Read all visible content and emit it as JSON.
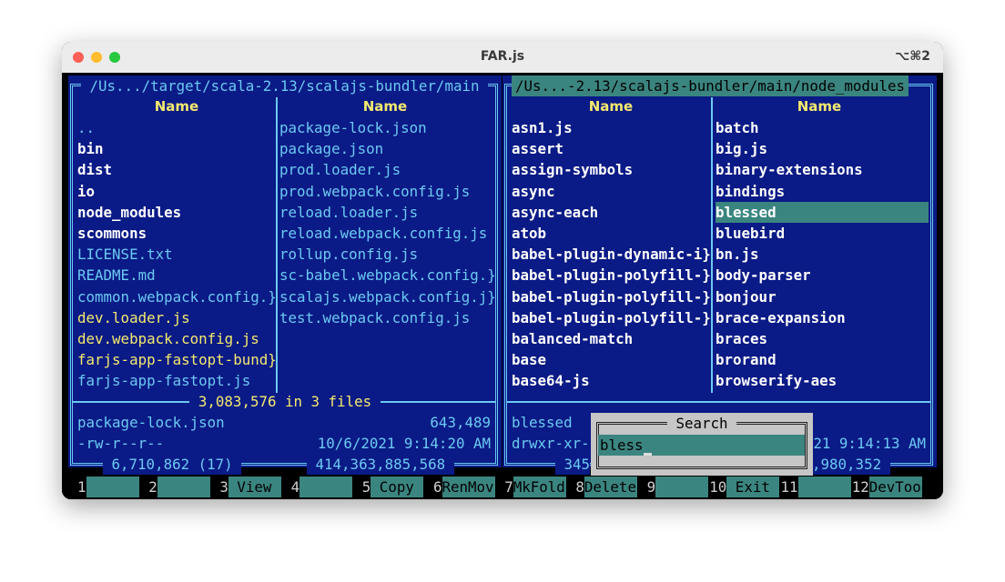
{
  "window": {
    "title": "FAR.js",
    "shortcut": "⌥⌘2",
    "traffic_lights": {
      "close": "#fe5f57",
      "minimize": "#febc2e",
      "zoom": "#28c840"
    }
  },
  "colors": {
    "background": "#0a1a86",
    "border": "#6ccaf2",
    "directory": "#ffffff",
    "file": "#6ccaf2",
    "script": "#f4ea6e",
    "selection": "#3b8580"
  },
  "left_panel": {
    "path": " /Us.../target/scala-2.13/scalajs-bundler/main ",
    "column_header": "Name",
    "col1": [
      {
        "name": "..",
        "kind": "file"
      },
      {
        "name": "bin",
        "kind": "dir"
      },
      {
        "name": "dist",
        "kind": "dir"
      },
      {
        "name": "io",
        "kind": "dir"
      },
      {
        "name": "node_modules",
        "kind": "dir"
      },
      {
        "name": "scommons",
        "kind": "dir"
      },
      {
        "name": "LICENSE.txt",
        "kind": "file"
      },
      {
        "name": "README.md",
        "kind": "file"
      },
      {
        "name": "common.webpack.config.}",
        "kind": "file"
      },
      {
        "name": "dev.loader.js",
        "kind": "script"
      },
      {
        "name": "dev.webpack.config.js",
        "kind": "script"
      },
      {
        "name": "farjs-app-fastopt-bund}",
        "kind": "script"
      },
      {
        "name": "farjs-app-fastopt.js",
        "kind": "file"
      }
    ],
    "col2": [
      {
        "name": "package-lock.json",
        "kind": "file"
      },
      {
        "name": "package.json",
        "kind": "file"
      },
      {
        "name": "prod.loader.js",
        "kind": "file"
      },
      {
        "name": "prod.webpack.config.js",
        "kind": "file"
      },
      {
        "name": "reload.loader.js",
        "kind": "file"
      },
      {
        "name": "reload.webpack.config.js",
        "kind": "file"
      },
      {
        "name": "rollup.config.js",
        "kind": "file"
      },
      {
        "name": "sc-babel.webpack.config.}",
        "kind": "file"
      },
      {
        "name": "scalajs.webpack.config.j}",
        "kind": "file"
      },
      {
        "name": "test.webpack.config.js",
        "kind": "file"
      }
    ],
    "selection_summary": " 3,083,576 in 3 files ",
    "info": {
      "name": "package-lock.json",
      "size": "643,489",
      "perms": "-rw-r--r--",
      "date": "10/6/2021 9:14:20 AM"
    },
    "footer": {
      "files": " 6,710,862 (17) ",
      "free": " 414,363,885,568 "
    }
  },
  "right_panel": {
    "path": "/Us...-2.13/scalajs-bundler/main/node_modules",
    "column_header": "Name",
    "selected": "blessed",
    "col1": [
      "asn1.js",
      "assert",
      "assign-symbols",
      "async",
      "async-each",
      "atob",
      "babel-plugin-dynamic-i}",
      "babel-plugin-polyfill-}",
      "babel-plugin-polyfill-}",
      "babel-plugin-polyfill-}",
      "balanced-match",
      "base",
      "base64-js"
    ],
    "col2": [
      "batch",
      "big.js",
      "binary-extensions",
      "bindings",
      "blessed",
      "bluebird",
      "bn.js",
      "body-parser",
      "bonjour",
      "brace-expansion",
      "braces",
      "brorand",
      "browserify-aes"
    ],
    "info": {
      "name": "blessed",
      "perms_visible": "drwxr-xr-",
      "date_visible": "21 9:14:13 AM"
    },
    "footer": {
      "files_visible": " 345",
      "free_visible": ",980,352 "
    }
  },
  "search_dialog": {
    "title": " Search ",
    "value": "bless"
  },
  "function_keys": [
    {
      "num": "1",
      "label": ""
    },
    {
      "num": "2",
      "label": ""
    },
    {
      "num": "3",
      "label": " View"
    },
    {
      "num": "4",
      "label": ""
    },
    {
      "num": "5",
      "label": " Copy"
    },
    {
      "num": "6",
      "label": "RenMov"
    },
    {
      "num": "7",
      "label": "MkFold"
    },
    {
      "num": "8",
      "label": "Delete"
    },
    {
      "num": "9",
      "label": ""
    },
    {
      "num": "10",
      "label": " Exit"
    },
    {
      "num": "11",
      "label": ""
    },
    {
      "num": "12",
      "label": "DevToo"
    }
  ]
}
